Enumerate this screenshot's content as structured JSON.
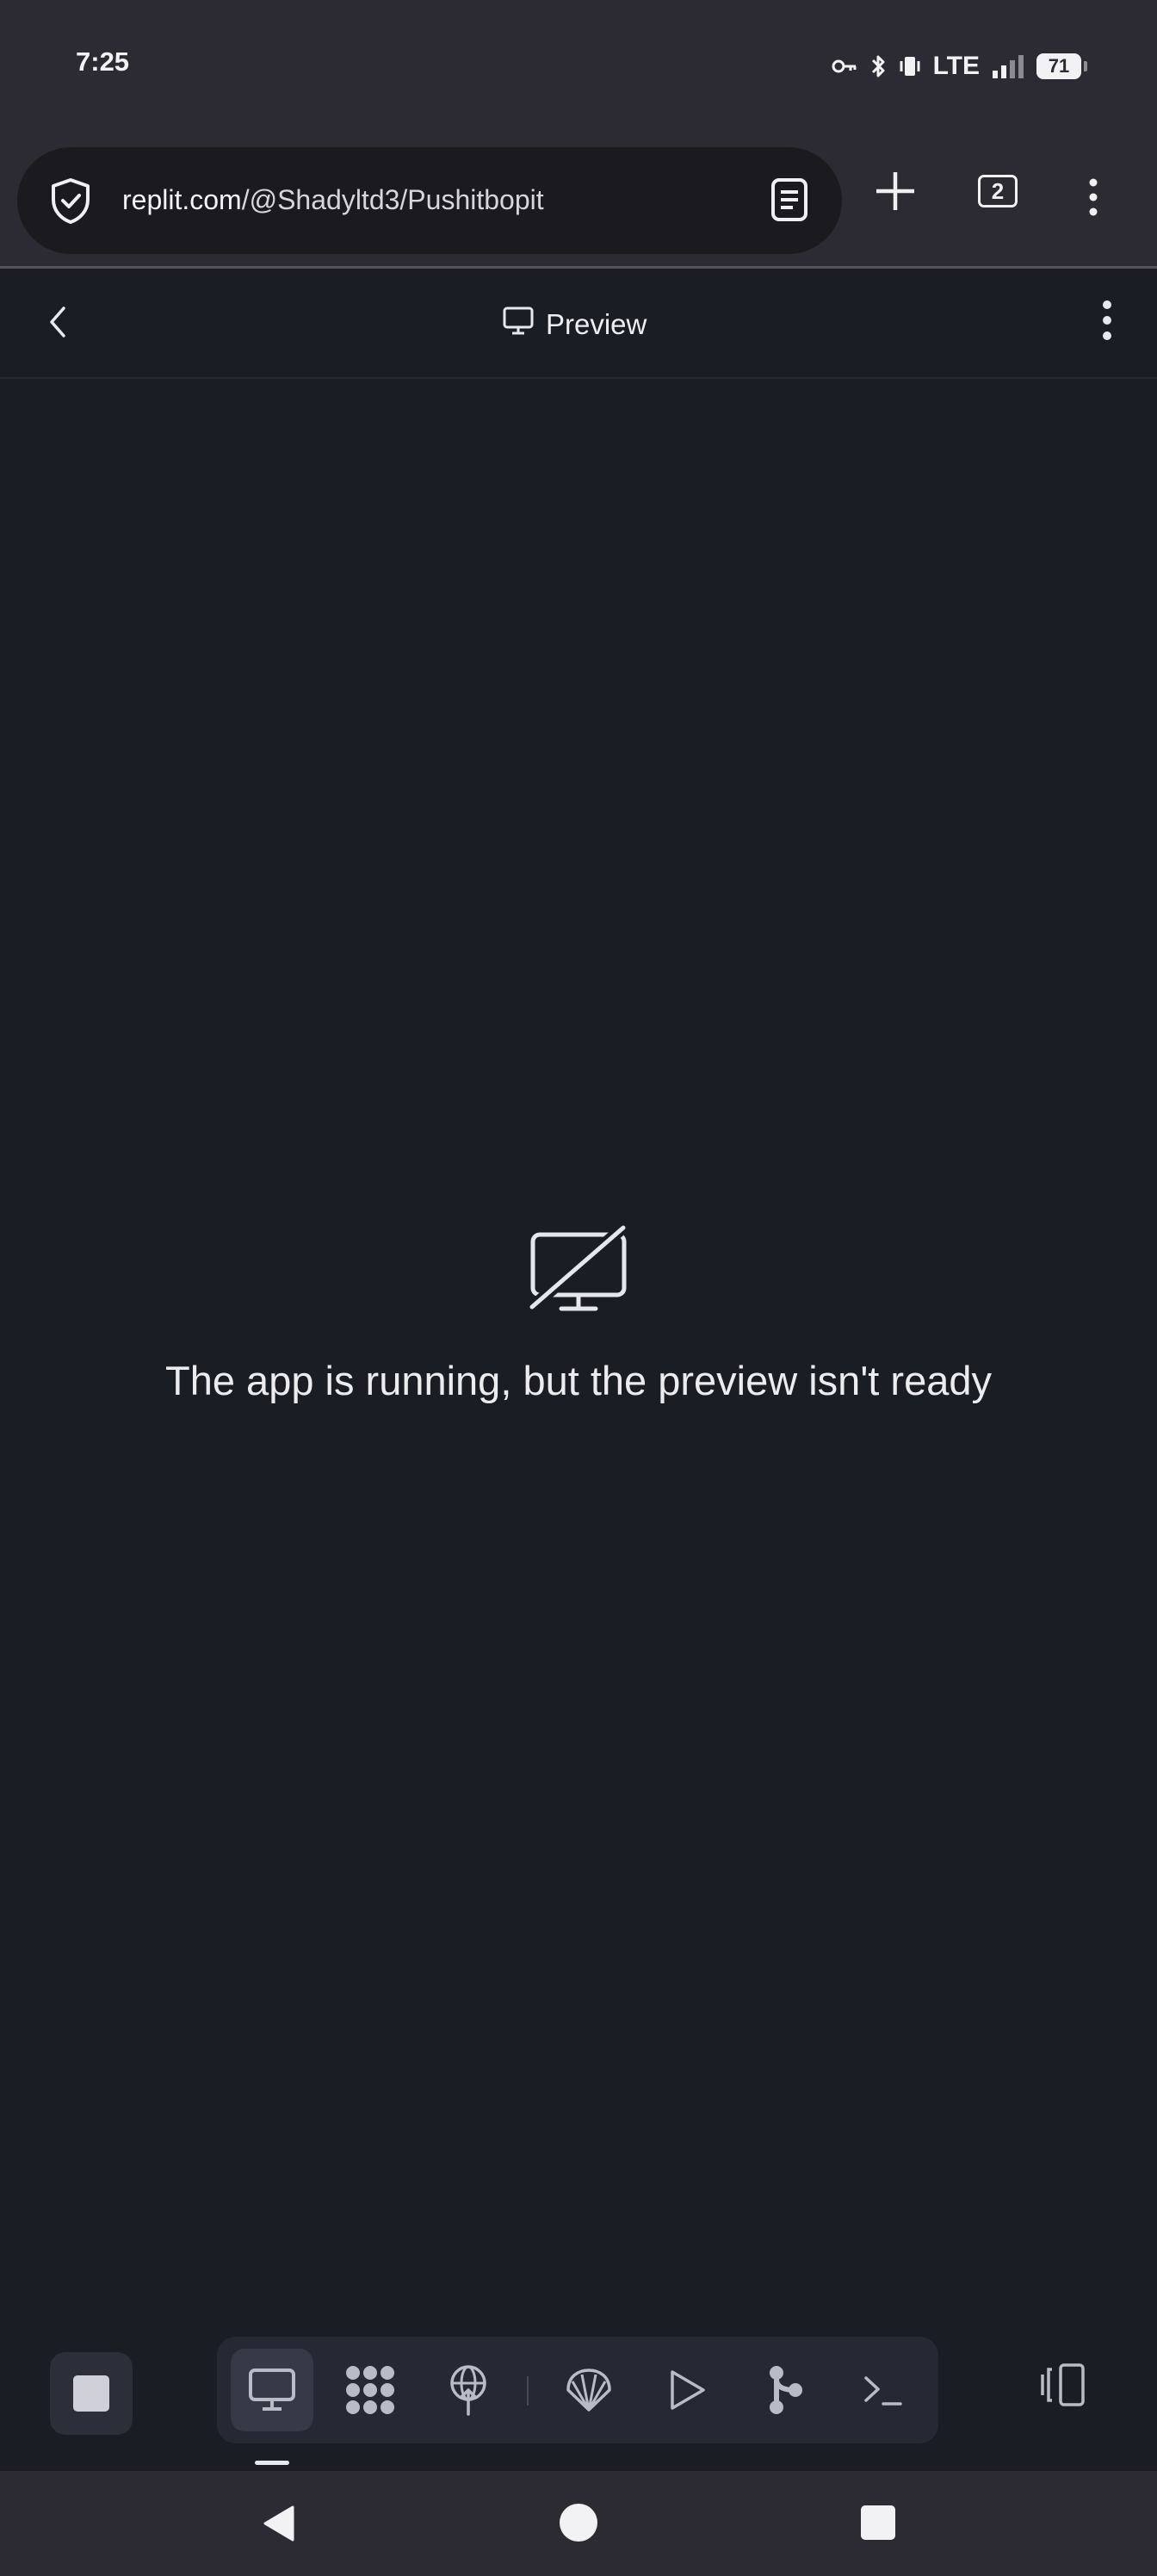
{
  "status_bar": {
    "time": "7:25",
    "network": "LTE",
    "battery": "71",
    "icons": [
      "vpn-key-icon",
      "bluetooth-icon",
      "vibrate-icon",
      "signal-icon",
      "battery-icon"
    ]
  },
  "browser": {
    "url_host": "replit.com",
    "url_path": "/@Shadyltd3/Pushitbopit",
    "tab_count": "2",
    "icons": [
      "security-shield-icon",
      "reader-mode-icon",
      "new-tab-plus-icon",
      "tab-switcher-icon",
      "browser-menu-icon"
    ]
  },
  "preview_header": {
    "title": "Preview",
    "icons": [
      "back-chevron-icon",
      "monitor-icon",
      "more-vertical-icon"
    ]
  },
  "main": {
    "message": "The app is running, but the preview isn't ready",
    "icon": "monitor-off-icon"
  },
  "toolbar": {
    "tools": [
      "preview",
      "extensions",
      "deployments",
      "ai-agent",
      "run",
      "git",
      "shell"
    ],
    "active_tool": "preview"
  },
  "colors": {
    "background": "#1b1d25",
    "chrome": "#2c2b33",
    "toolbar": "#262833",
    "text": "#ececf0"
  }
}
